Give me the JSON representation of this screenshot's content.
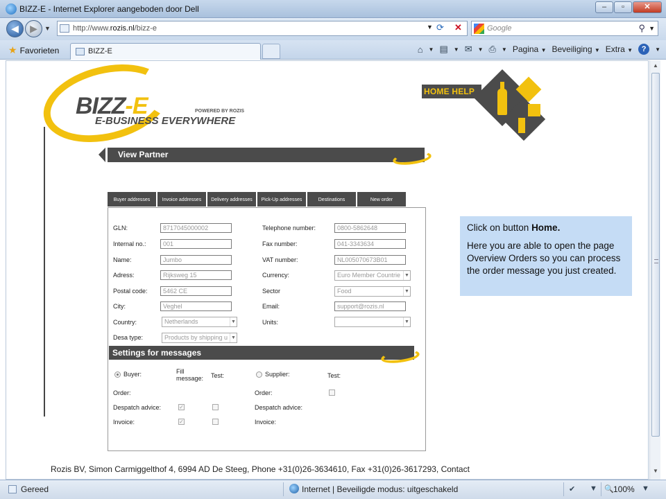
{
  "browser": {
    "window_title": "BIZZ-E - Internet Explorer aangeboden door Dell",
    "url_prefix": "http://www.",
    "url_domain": "rozis.nl",
    "url_path": "/bizz-e",
    "search_placeholder": "Google",
    "favorites_label": "Favorieten",
    "tab_title": "BIZZ-E",
    "cmd_pagina": "Pagina",
    "cmd_beveiliging": "Beveiliging",
    "cmd_extra": "Extra",
    "status_text": "Gereed",
    "status_zone": "Internet | Beveiligde modus: uitgeschakeld",
    "zoom": "100%"
  },
  "page": {
    "logo_main": "BIZZ",
    "logo_dash": "-E",
    "logo_tagline": "E-BUSINESS EVERYWHERE",
    "logo_powered": "POWERED BY ROZIS",
    "home_help": "HOME HELP",
    "section_title": "View Partner",
    "tabs": [
      "Buyer addresses",
      "Invoice addresses",
      "Delivery addresses",
      "Pick-Up addresses",
      "Destinations",
      "New order"
    ],
    "form_left": [
      {
        "label": "GLN:",
        "value": "8717045000002"
      },
      {
        "label": "Internal no.:",
        "value": "001"
      },
      {
        "label": "Name:",
        "value": "Jumbo"
      },
      {
        "label": "Adress:",
        "value": "Rijksweg 15"
      },
      {
        "label": "Postal code:",
        "value": "5462 CE"
      },
      {
        "label": "City:",
        "value": "Veghel"
      }
    ],
    "country_label": "Country:",
    "country_value": "Netherlands",
    "desa_label": "Desa type:",
    "desa_value": "Products by shipping u",
    "form_right": [
      {
        "label": "Telephone number:",
        "value": "0800-5862648"
      },
      {
        "label": "Fax number:",
        "value": "041-3343634"
      },
      {
        "label": "VAT number:",
        "value": "NL005070673B01"
      }
    ],
    "currency_label": "Currency:",
    "currency_value": "Euro Member Countrie",
    "sector_label": "Sector",
    "sector_value": "Food",
    "email_label": "Email:",
    "email_value": "support@rozis.nl",
    "units_label": "Units:",
    "units_value": "",
    "settings_title": "Settings for messages",
    "buyer_label": "Buyer:",
    "fill_message_label": "Fill message:",
    "test_label": "Test:",
    "supplier_label": "Supplier:",
    "supplier_test_label": "Test:",
    "order_label": "Order:",
    "despatch_label": "Despatch advice:",
    "invoice_label": "Invoice:",
    "supplier_order_label": "Order:",
    "supplier_despatch_label": "Despatch advice:",
    "supplier_invoice_label": "Invoice:",
    "footer": "Rozis BV, Simon Carmiggelthof 4, 6994 AD De Steeg, Phone +31(0)26-3634610, Fax +31(0)26-3617293, Contact"
  },
  "callout": {
    "line1_prefix": "Click on button ",
    "line1_bold": "Home.",
    "line2": "Here you are able to open the page Overview Orders so you can process the order message you just created."
  },
  "colors": {
    "brand_yellow": "#f2c10f",
    "brand_dark": "#4b4b4b",
    "callout_bg": "#c5dcf5"
  }
}
